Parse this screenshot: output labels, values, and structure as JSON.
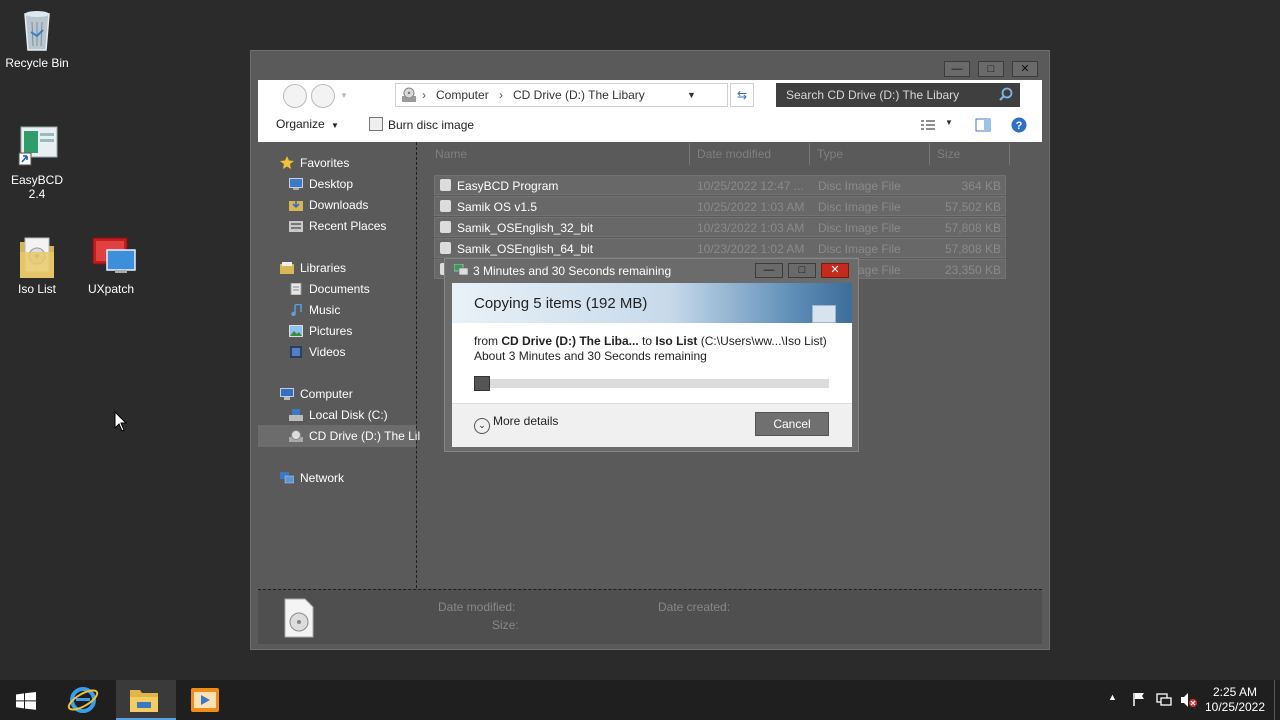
{
  "desktop": {
    "icons": [
      {
        "label": "Recycle Bin"
      },
      {
        "label": "EasyBCD 2.4"
      },
      {
        "label": "Iso List"
      },
      {
        "label": "UXpatch"
      }
    ]
  },
  "explorer": {
    "caption_buttons": {
      "minimize": "—",
      "maximize": "□",
      "close": "✕"
    },
    "address": {
      "root": "Computer",
      "location": "CD Drive (D:) The Libary"
    },
    "search": {
      "placeholder": "Search CD Drive (D:) The Libary"
    },
    "toolbar": {
      "organize": "Organize",
      "burn": "Burn disc image"
    },
    "nav": {
      "favorites": "Favorites",
      "desktop": "Desktop",
      "downloads": "Downloads",
      "recent": "Recent Places",
      "libraries": "Libraries",
      "documents": "Documents",
      "music": "Music",
      "pictures": "Pictures",
      "videos": "Videos",
      "computer": "Computer",
      "local_disk": "Local Disk (C:)",
      "cd_drive": "CD Drive (D:) The Lil",
      "network": "Network"
    },
    "columns": {
      "name": "Name",
      "date": "Date modified",
      "type": "Type",
      "size": "Size"
    },
    "files": [
      {
        "name": "EasyBCD Program",
        "date": "10/25/2022 12:47 ...",
        "type": "Disc Image File",
        "size": "364 KB"
      },
      {
        "name": "Samik OS v1.5",
        "date": "10/25/2022 1:03 AM",
        "type": "Disc Image File",
        "size": "57,502 KB"
      },
      {
        "name": "Samik_OSEnglish_32_bit",
        "date": "10/23/2022 1:03 AM",
        "type": "Disc Image File",
        "size": "57,808 KB"
      },
      {
        "name": "Samik_OSEnglish_64_bit",
        "date": "10/23/2022 1:02 AM",
        "type": "Disc Image File",
        "size": "57,808 KB"
      },
      {
        "name": "",
        "date": "",
        "type": "Disc Image File",
        "size": "23,350 KB"
      }
    ],
    "details": {
      "date_modified_label": "Date modified:",
      "date_created_label": "Date created:",
      "size_label": "Size:"
    }
  },
  "copy_dialog": {
    "title": "3 Minutes and 30 Seconds remaining",
    "heading": "Copying 5 items (192 MB)",
    "from_word": "from",
    "source": "CD Drive (D:) The Liba...",
    "to_word": "to",
    "destination": "Iso List",
    "destination_path": "(C:\\Users\\ww...\\Iso List)",
    "remaining": "About 3 Minutes and 30 Seconds remaining",
    "progress_fraction": 0.045,
    "more_details": "More details",
    "cancel": "Cancel"
  },
  "taskbar": {
    "time": "2:25 AM",
    "date": "10/25/2022"
  }
}
